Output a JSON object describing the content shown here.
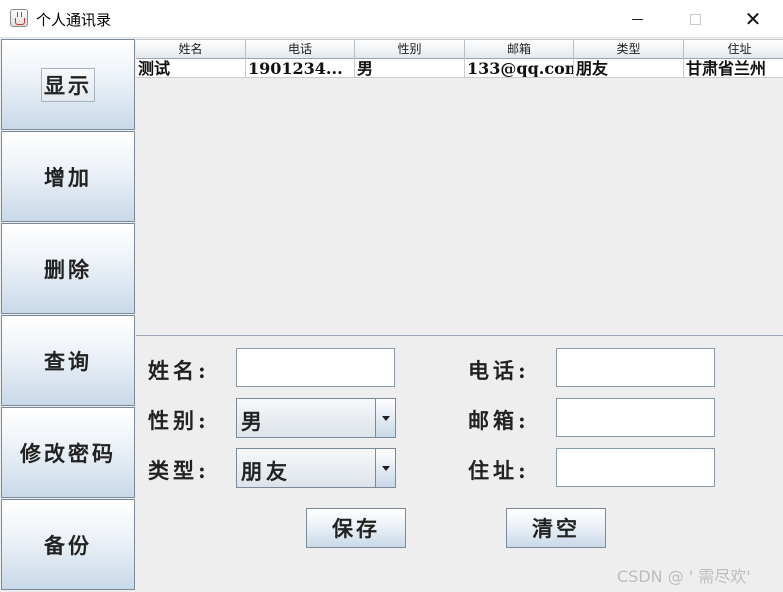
{
  "window": {
    "title": "个人通讯录",
    "icon": "java-cup-icon"
  },
  "sidebar": {
    "items": [
      {
        "label": "显示"
      },
      {
        "label": "增加"
      },
      {
        "label": "删除"
      },
      {
        "label": "查询"
      },
      {
        "label": "修改密码"
      },
      {
        "label": "备份"
      }
    ]
  },
  "table": {
    "headers": [
      "姓名",
      "电话",
      "性别",
      "邮箱",
      "类型",
      "住址"
    ],
    "rows": [
      [
        "测试",
        "1901234...",
        "男",
        "133@qq.com",
        "朋友",
        "甘肃省兰州"
      ]
    ]
  },
  "form": {
    "name_label": "姓名:",
    "phone_label": "电话:",
    "gender_label": "性别:",
    "email_label": "邮箱:",
    "type_label": "类型:",
    "address_label": "住址:",
    "name_value": "",
    "phone_value": "",
    "email_value": "",
    "address_value": "",
    "gender_selected": "男",
    "type_selected": "朋友"
  },
  "actions": {
    "save_label": "保存",
    "clear_label": "清空"
  },
  "watermark": "CSDN @ ' 需尽欢'"
}
